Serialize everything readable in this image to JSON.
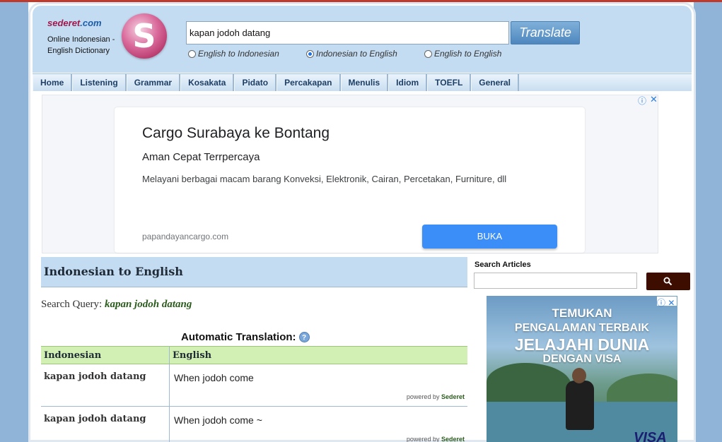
{
  "site": {
    "name": "sederet",
    "domain": ".com",
    "tagline": "Online Indonesian - English Dictionary",
    "logo_letter": "S"
  },
  "search": {
    "value": "kapan jodoh datang",
    "translate_label": "Translate"
  },
  "directions": [
    {
      "label": "English to Indonesian",
      "selected": false
    },
    {
      "label": "Indonesian to English",
      "selected": true
    },
    {
      "label": "English to English",
      "selected": false
    }
  ],
  "nav": [
    "Home",
    "Listening",
    "Grammar",
    "Kosakata",
    "Pidato",
    "Percakapan",
    "Menulis",
    "Idiom",
    "TOEFL",
    "General"
  ],
  "ad_top": {
    "title": "Cargo Surabaya ke Bontang",
    "subtitle": "Aman Cepat Terrpercaya",
    "text": "Melayani berbagai macam barang Konveksi, Elektronik, Cairan, Percetakan, Furniture, dll",
    "domain": "papandayancargo.com",
    "button": "BUKA"
  },
  "main": {
    "section_title": "Indonesian to English",
    "query_label": "Search Query:",
    "query_value": "kapan jodoh datang",
    "auto_translation_label": "Automatic Translation:"
  },
  "table": {
    "headers": [
      "Indonesian",
      "English"
    ],
    "rows": [
      {
        "indonesian": "kapan jodoh datang",
        "english": "When jodoh come"
      },
      {
        "indonesian": "kapan jodoh datang",
        "english": "When jodoh come ~"
      }
    ],
    "powered_prefix": "powered by",
    "powered_brand": "Sederet"
  },
  "sidebar": {
    "search_articles_label": "Search Articles",
    "ad": {
      "line1": "TEMUKAN",
      "line2": "PENGALAMAN TERBAIK",
      "line3": "JELAJAHI DUNIA",
      "line4": "DENGAN VISA",
      "brand": "VISA"
    }
  },
  "colors": {
    "header_bg": "#c4dcf2",
    "brand_magenta": "#a0174b",
    "ad_button": "#3b8ef8",
    "table_header": "#d3f0b4",
    "search_articles_button": "#3d0e00"
  }
}
